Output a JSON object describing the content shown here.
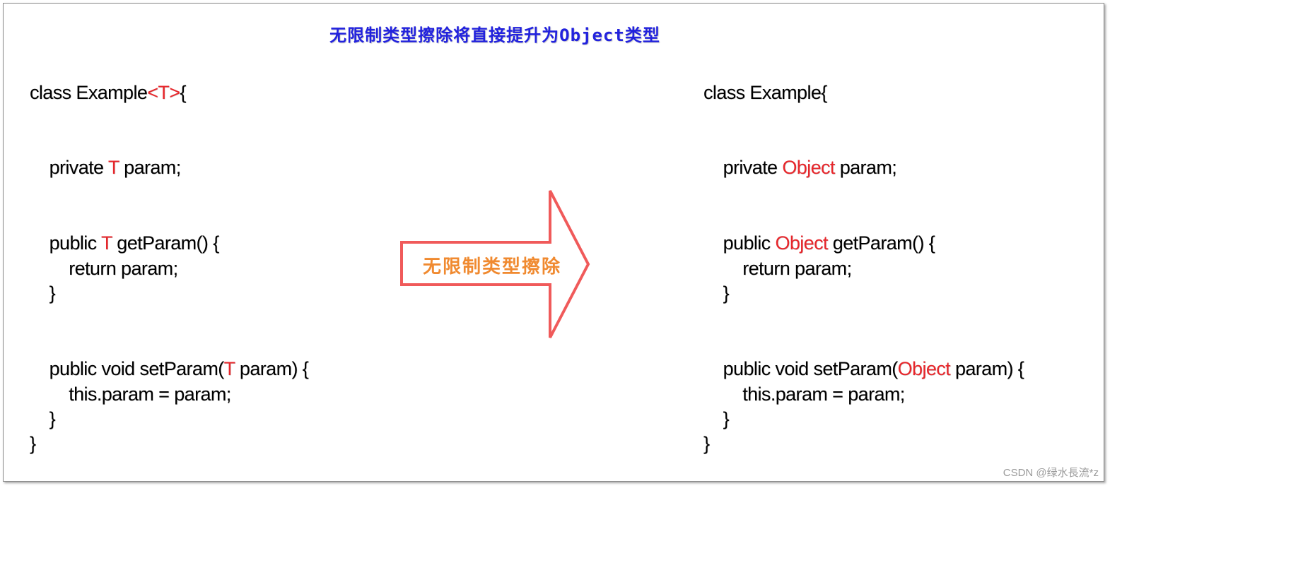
{
  "title": "无限制类型擦除将直接提升为Object类型",
  "arrow_label": "无限制类型擦除",
  "colors": {
    "title": "#2222dd",
    "keyword_highlight": "#e8262b",
    "arrow_stroke": "#f05a5a",
    "arrow_label": "#f08a30"
  },
  "left_code": {
    "class_decl": {
      "pre": "class Example",
      "hl": "<T>",
      "post": "{"
    },
    "field": {
      "pre": "    private ",
      "hl": "T",
      "post": " param;"
    },
    "getter_sig": {
      "pre": "    public ",
      "hl": "T",
      "post": " getParam() {"
    },
    "getter_body": "        return param;",
    "getter_close": "    }",
    "setter_sig": {
      "pre": "    public void setParam(",
      "hl": "T",
      "post": " param) {"
    },
    "setter_body": "        this.param = param;",
    "setter_close": "    }",
    "class_close": "}"
  },
  "right_code": {
    "class_decl": "class Example{",
    "field": {
      "pre": "    private ",
      "hl": "Object",
      "post": " param;"
    },
    "getter_sig": {
      "pre": "    public ",
      "hl": "Object",
      "post": " getParam() {"
    },
    "getter_body": "        return param;",
    "getter_close": "    }",
    "setter_sig": {
      "pre": "    public void setParam(",
      "hl": "Object",
      "post": " param) {"
    },
    "setter_body": "        this.param = param;",
    "setter_close": "    }",
    "class_close": "}"
  },
  "watermark": "CSDN @绿水長流*z"
}
